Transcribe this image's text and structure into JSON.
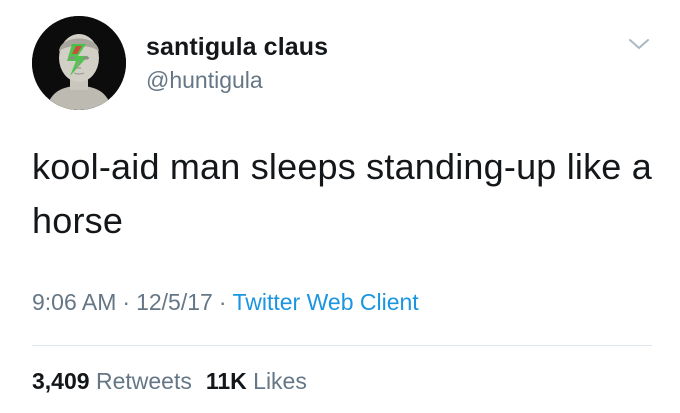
{
  "user": {
    "display_name": "santigula claus",
    "handle": "@huntigula"
  },
  "tweet": {
    "text": "kool-aid man sleeps standing-up like a horse",
    "time": "9:06 AM",
    "separator": "·",
    "date": "12/5/17",
    "client": "Twitter Web Client"
  },
  "stats": {
    "retweets_count": "3,409",
    "retweets_label": "Retweets",
    "likes_count": "11K",
    "likes_label": "Likes"
  },
  "icons": {
    "caret": "chevron-down-icon",
    "avatar": "avatar"
  },
  "colors": {
    "text": "#14171a",
    "secondary": "#657786",
    "link": "#1b95e0",
    "divider": "#e1e8ed"
  }
}
